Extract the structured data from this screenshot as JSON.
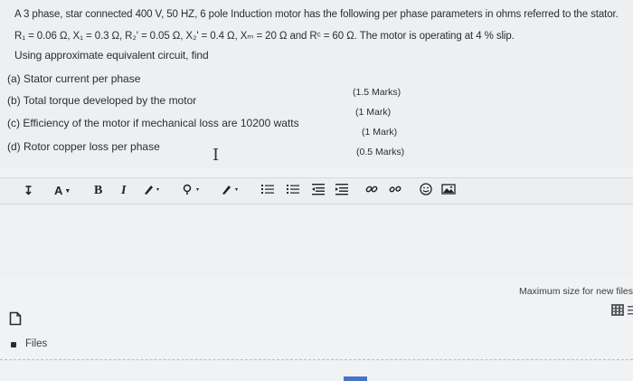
{
  "question": {
    "line1": "A 3 phase, star connected 400 V, 50 HZ, 6 pole Induction motor has the following per phase parameters in ohms referred to the stator.",
    "line2": "R₁ = 0.06 Ω, X₁ = 0.3 Ω, R₂' = 0.05 Ω, X₂' = 0.4 Ω, Xₘ = 20 Ω and Rᶜ = 60 Ω. The motor is operating at 4 % slip.",
    "line3": "Using approximate equivalent circuit, find",
    "parts": [
      {
        "label": "(a) Stator current per phase",
        "marks": "(1.5 Marks)"
      },
      {
        "label": "(b) Total torque developed by the motor",
        "marks": "(1 Mark)"
      },
      {
        "label": "(c) Efficiency of the motor if mechanical loss are 10200 watts",
        "marks": "(1 Mark)"
      },
      {
        "label": "(d) Rotor copper loss per phase",
        "marks": "(0.5 Marks)"
      }
    ]
  },
  "toolbar": {
    "expand_icon": "↧",
    "font_color": "A",
    "bold": "B",
    "italic": "I"
  },
  "attachments": {
    "max_size_text": "Maximum size for new files",
    "files_label": "Files"
  }
}
